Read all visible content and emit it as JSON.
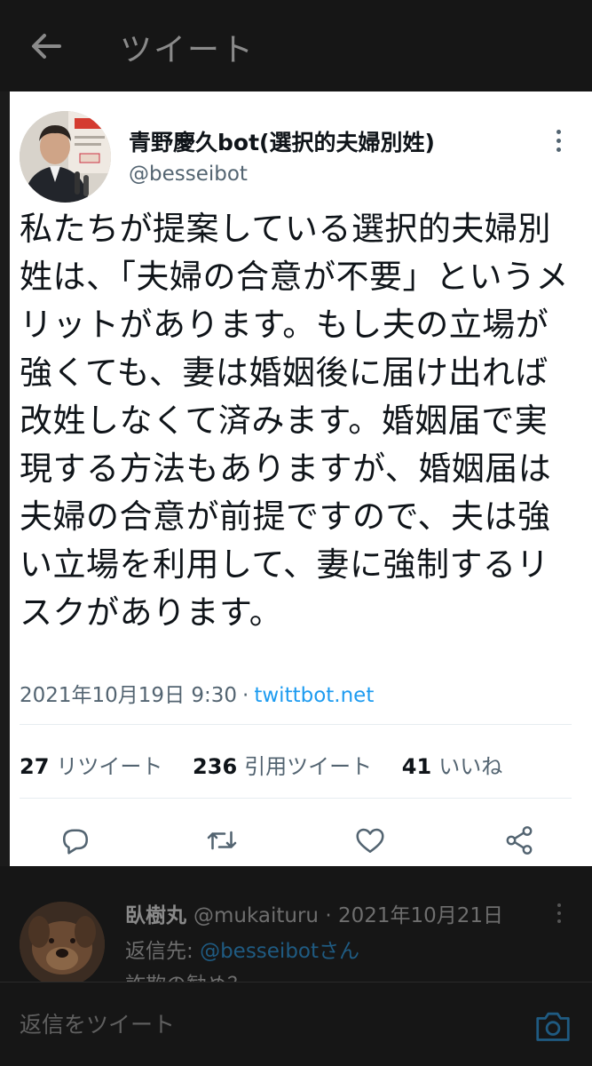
{
  "header": {
    "title": "ツイート",
    "back_icon": "arrow-left-icon"
  },
  "tweet": {
    "author_name": "青野慶久bot(選択的夫婦別姓)",
    "author_handle": "@besseibot",
    "text": "私たちが提案している選択的夫婦別姓は、「夫婦の合意が不要」というメリットがあります。もし夫の立場が強くても、妻は婚姻後に届け出れば改姓しなくて済みます。婚姻届で実現する方法もありますが、婚姻届は夫婦の合意が前提ですので、夫は強い立場を利用して、妻に強制するリスクがあります。",
    "timestamp": "2021年10月19日 9:30",
    "separator": "·",
    "source": "twittbot.net",
    "stats": {
      "retweets_count": "27",
      "retweets_label": "リツイート",
      "quotes_count": "236",
      "quotes_label": "引用ツイート",
      "likes_count": "41",
      "likes_label": "いいね"
    },
    "actions": [
      "reply-icon",
      "retweet-icon",
      "like-icon",
      "share-icon"
    ]
  },
  "reply": {
    "author_name": "臥樹丸",
    "author_handle": "@mukaituru",
    "separator": "·",
    "date": "2021年10月21日",
    "reply_to_prefix": "返信先: ",
    "reply_to_mention": "@besseibotさん",
    "snippet": "詐欺の勧め？..."
  },
  "composer": {
    "placeholder": "返信をツイート",
    "camera_icon": "camera-icon"
  },
  "colors": {
    "accent": "#1d9bf0",
    "text_primary": "#0f1419",
    "text_secondary": "#536471",
    "overlay_bg": "#1b1b1b"
  }
}
